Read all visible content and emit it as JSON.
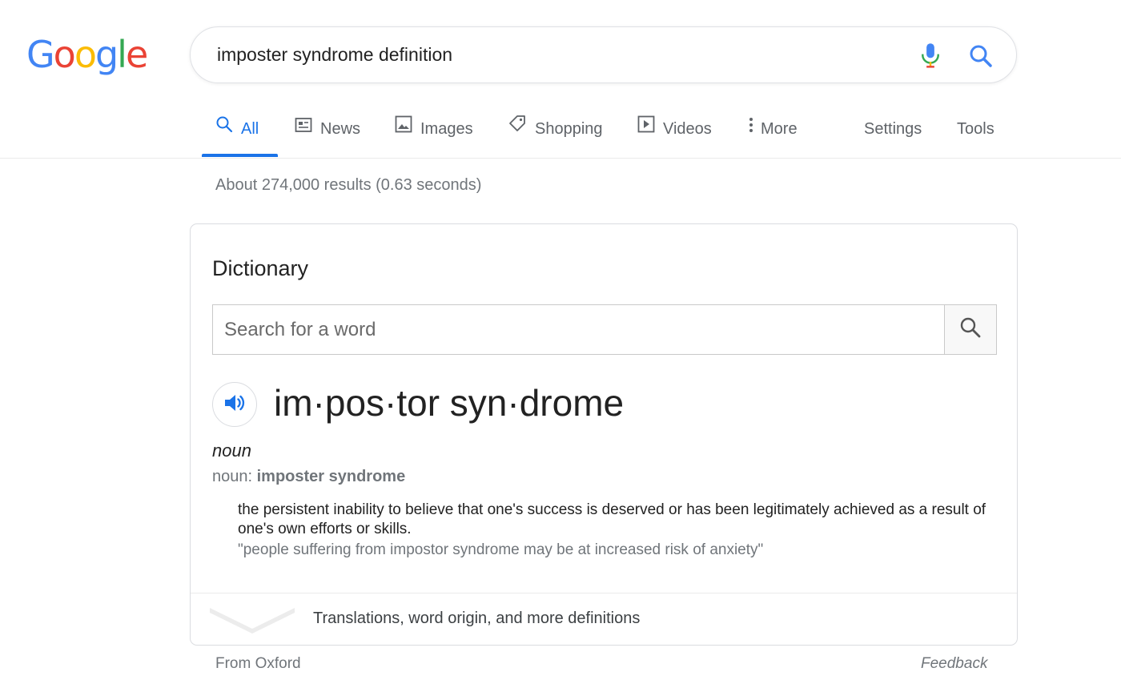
{
  "logo": {
    "letters": [
      {
        "char": "G",
        "color": "#4285f4"
      },
      {
        "char": "o",
        "color": "#ea4335"
      },
      {
        "char": "o",
        "color": "#fbbc05"
      },
      {
        "char": "g",
        "color": "#4285f4"
      },
      {
        "char": "l",
        "color": "#34a853"
      },
      {
        "char": "e",
        "color": "#ea4335"
      }
    ]
  },
  "search": {
    "query": "imposter syndrome definition",
    "mic_icon": "microphone-icon",
    "search_icon": "search-icon"
  },
  "tabs": {
    "all": "All",
    "news": "News",
    "images": "Images",
    "shopping": "Shopping",
    "videos": "Videos",
    "more": "More",
    "settings": "Settings",
    "tools": "Tools",
    "active": "all"
  },
  "results_count": "About 274,000 results (0.63 seconds)",
  "dictionary": {
    "title": "Dictionary",
    "search_placeholder": "Search for a word",
    "headword": "im·pos·tor syn·drome",
    "part_of_speech": "noun",
    "variant_prefix": "noun: ",
    "variant_term": "imposter syndrome",
    "definition": "the persistent inability to believe that one's success is deserved or has been legitimately achieved as a result of one's own efforts or skills.",
    "example": "\"people suffering from impostor syndrome may be at increased risk of anxiety\"",
    "expand_label": "Translations, word origin, and more definitions"
  },
  "footer": {
    "source": "From Oxford",
    "feedback": "Feedback"
  },
  "colors": {
    "accent": "#1a73e8",
    "text": "#222222",
    "muted": "#70757a"
  }
}
